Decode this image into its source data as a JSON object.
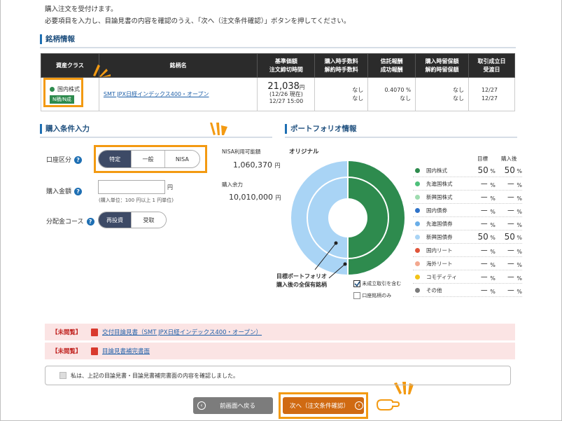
{
  "intro": {
    "line1": "購入注文を受付けます。",
    "line2": "必要項目を入力し、目論見書の内容を確認のうえ、「次へ（注文条件確認）」ボタンを押してください。"
  },
  "brand_section": {
    "title": "銘柄情報",
    "headers": {
      "asset_class": "資産クラス",
      "fund_name": "銘柄名",
      "base_price_1": "基準価額",
      "base_price_2": "注文締切時間",
      "fee_1": "購入時手数料",
      "fee_2": "解約時手数料",
      "trust_1": "信託報酬",
      "trust_2": "成功報酬",
      "reserve_1": "購入時留保額",
      "reserve_2": "解約時留保額",
      "date_1": "取引成立日",
      "date_2": "受渡日"
    },
    "row": {
      "asset_class": "国内株式",
      "nisa_badge": "N積/N成",
      "fund_name": "SMT JPX日経インデックス400・オープン",
      "price": "21,038",
      "price_unit": "円",
      "price_date": "(12/26 現在)",
      "deadline": "12/27 15:00",
      "buy_fee": "なし",
      "sell_fee": "なし",
      "trust_fee": "0.4070",
      "trust_unit": "%",
      "success_fee": "なし",
      "buy_reserve": "なし",
      "sell_reserve": "なし",
      "trade_date": "12/27",
      "delivery_date": "12/27"
    }
  },
  "purchase_section": {
    "title": "購入条件入力",
    "account_label": "口座区分",
    "account_options": [
      "特定",
      "一般",
      "NISA"
    ],
    "nisa_limit_label": "NISA利用可能額",
    "nisa_limit_value": "1,060,370",
    "nisa_limit_unit": "円",
    "amount_label": "購入金額",
    "amount_unit": "円",
    "amount_note": "(購入単位：100 円以上 1 円単位)",
    "capacity_label": "購入余力",
    "capacity_value": "10,010,000",
    "capacity_unit": "円",
    "dist_label": "分配金コース",
    "dist_options": [
      "再投資",
      "受取"
    ]
  },
  "portfolio": {
    "title": "ポートフォリオ情報",
    "original_label": "オリジナル",
    "col_target": "目標",
    "col_after": "購入後",
    "annotation_1": "目標ポートフォリオ",
    "annotation_2": "購入後の全保有銘柄",
    "chk_unsettled": "未成立取引を含む",
    "chk_account_only": "口座銘柄のみ",
    "items": [
      {
        "name": "国内株式",
        "color": "#2e8b4e",
        "target": "50",
        "after": "50"
      },
      {
        "name": "先進国株式",
        "color": "#4ec07a",
        "target": "－",
        "after": "－"
      },
      {
        "name": "新興国株式",
        "color": "#9fdcb0",
        "target": "－",
        "after": "－"
      },
      {
        "name": "国内債券",
        "color": "#2f73c9",
        "target": "－",
        "after": "－"
      },
      {
        "name": "先進国債券",
        "color": "#6aaee8",
        "target": "－",
        "after": "－"
      },
      {
        "name": "新興国債券",
        "color": "#a9d4f5",
        "target": "50",
        "after": "50"
      },
      {
        "name": "国内リート",
        "color": "#e0553a",
        "target": "－",
        "after": "－"
      },
      {
        "name": "海外リート",
        "color": "#f3a88f",
        "target": "－",
        "after": "－"
      },
      {
        "name": "コモディティ",
        "color": "#f2c318",
        "target": "－",
        "after": "－"
      },
      {
        "name": "その他",
        "color": "#7b7b7b",
        "target": "－",
        "after": "－"
      }
    ],
    "pct": "%"
  },
  "docs": {
    "unread_1": "【未閲覧】",
    "doc_1": "交付目論見書（SMT JPX日経インデックス400・オープン）",
    "unread_2": "【未閲覧】",
    "doc_2": "目論見書補完書面",
    "confirm_text": "私は、上記の目論見書・目論見書補完書面の内容を確認しました。"
  },
  "buttons": {
    "back": "前画面へ戻る",
    "next": "次へ（注文条件確認）"
  },
  "colors": {
    "accent": "#f39a12",
    "navy": "#3d4a66",
    "next_btn": "#d06a12",
    "back_btn": "#7c7c7c"
  }
}
